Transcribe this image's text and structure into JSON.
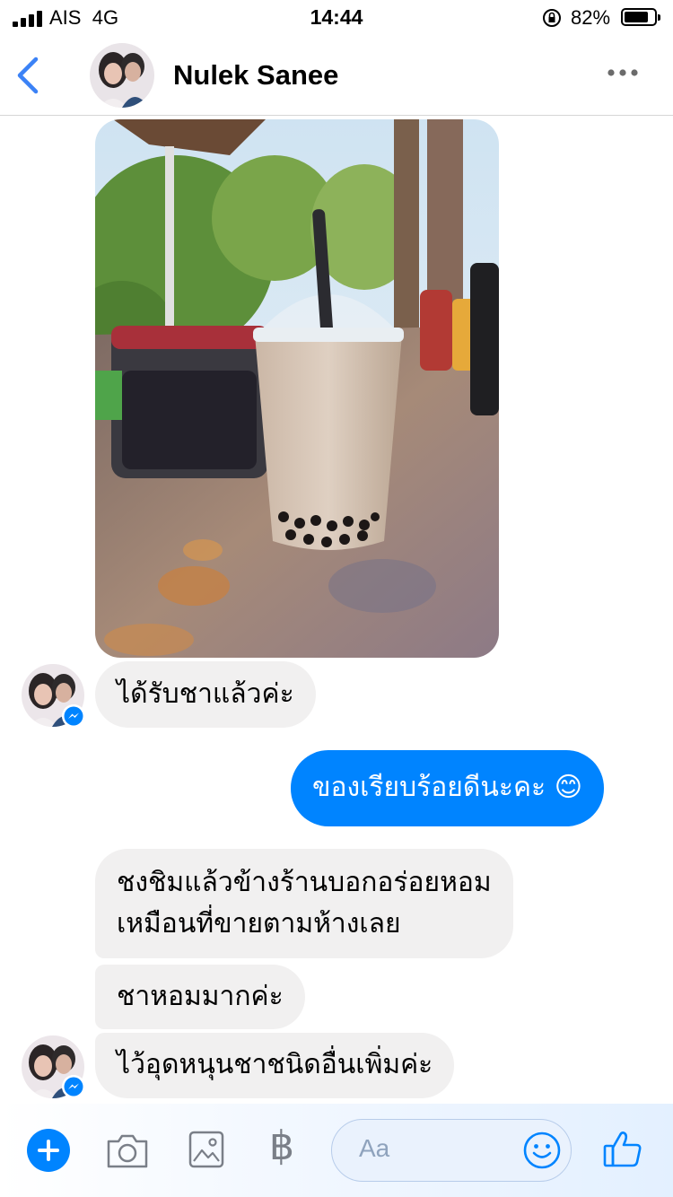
{
  "status_bar": {
    "carrier": "AIS",
    "network": "4G",
    "time": "14:44",
    "battery_percent": "82%",
    "battery_level": 0.82
  },
  "header": {
    "contact_name": "Nulek Sanee"
  },
  "messages": [
    {
      "direction": "incoming",
      "text": "ได้รับชาแล้วค่ะ"
    },
    {
      "direction": "outgoing",
      "text": "ของเรียบร้อยดีนะคะ 😊"
    },
    {
      "direction": "incoming",
      "text_line1": "ชงชิมแล้วข้างร้านบอกอร่อยหอม",
      "text_line2": "เหมือนที่ขายตามห้างเลย"
    },
    {
      "direction": "incoming",
      "text": "ชาหอมมากค่ะ"
    },
    {
      "direction": "incoming",
      "text": "ไว้อุดหนุนชาชนิดอื่นเพิ่มค่ะ"
    }
  ],
  "composer": {
    "placeholder": "Aa",
    "currency_symbol": "฿"
  },
  "colors": {
    "accent": "#0084ff",
    "incoming_bubble": "#f1f0f0",
    "header_icon": "#3b82f6"
  }
}
